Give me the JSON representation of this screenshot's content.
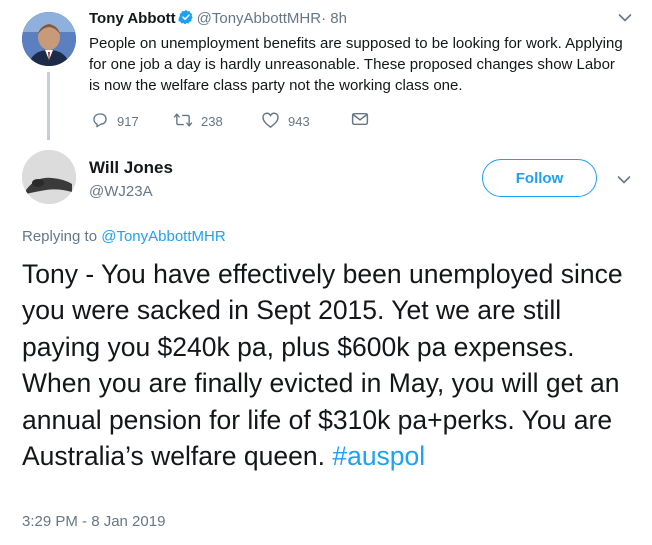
{
  "parent_tweet": {
    "name": "Tony Abbott",
    "handle": "@TonyAbbottMHR",
    "time": "· 8h",
    "text": "People on unemployment benefits are supposed to be looking for work. Applying for one job a day is hardly unreasonable. These proposed changes show Labor is now the welfare class party not the working class one.",
    "actions": {
      "reply_count": "917",
      "retweet_count": "238",
      "like_count": "943"
    }
  },
  "reply_tweet": {
    "name": "Will Jones",
    "handle": "@WJ23A",
    "follow_label": "Follow",
    "replying_prefix": "Replying to",
    "replying_to": "@TonyAbbottMHR",
    "text": "Tony - You have effectively been unemployed since you were sacked in Sept 2015. Yet we are still paying you $240k pa, plus $600k pa expenses. When you are finally evicted in May, you will get an annual pension for life of $310k pa+perks. You are Australia’s welfare queen.",
    "hashtag": "#auspol",
    "timestamp": "3:29 PM - 8 Jan 2019"
  },
  "colors": {
    "accent": "#1da1f2",
    "muted": "#657786",
    "text": "#14171a",
    "thread_line": "#c4cfd6"
  }
}
